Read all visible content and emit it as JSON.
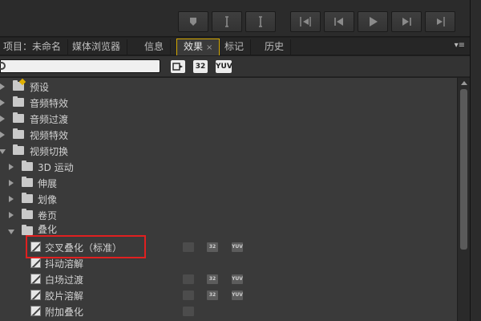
{
  "tabs": [
    {
      "label": "项目：未命名"
    },
    {
      "label": "媒体浏览器"
    },
    {
      "label": "信息"
    },
    {
      "label": "效果",
      "close": "×"
    },
    {
      "label": "标记"
    },
    {
      "label": "历史"
    }
  ],
  "panel_menu": "▾≡",
  "search": {
    "value": "",
    "placeholder": ""
  },
  "filter_badges": [
    "32",
    "YUV"
  ],
  "badge_labels": {
    "accel": "",
    "bit32": "32",
    "yuv": "YUV"
  },
  "tree": [
    {
      "label": "预设",
      "type": "folder",
      "expanded": false
    },
    {
      "label": "音频特效",
      "type": "folder",
      "expanded": false
    },
    {
      "label": "音频过渡",
      "type": "folder",
      "expanded": false
    },
    {
      "label": "视频特效",
      "type": "folder",
      "expanded": false
    },
    {
      "label": "视频切换",
      "type": "folder",
      "expanded": true
    },
    {
      "label": "3D 运动",
      "type": "folder",
      "expanded": false
    },
    {
      "label": "伸展",
      "type": "folder",
      "expanded": false
    },
    {
      "label": "划像",
      "type": "folder",
      "expanded": false
    },
    {
      "label": "卷页",
      "type": "folder",
      "expanded": false
    },
    {
      "label": "叠化",
      "type": "folder",
      "expanded": true
    },
    {
      "label": "交叉叠化（标准）",
      "type": "effect",
      "selected": true
    },
    {
      "label": "抖动溶解",
      "type": "effect"
    },
    {
      "label": "白场过渡",
      "type": "effect"
    },
    {
      "label": "胶片溶解",
      "type": "effect"
    },
    {
      "label": "附加叠化",
      "type": "effect"
    }
  ],
  "colors": {
    "highlight": "#e02020",
    "active_tab_border": "#d4a800"
  }
}
